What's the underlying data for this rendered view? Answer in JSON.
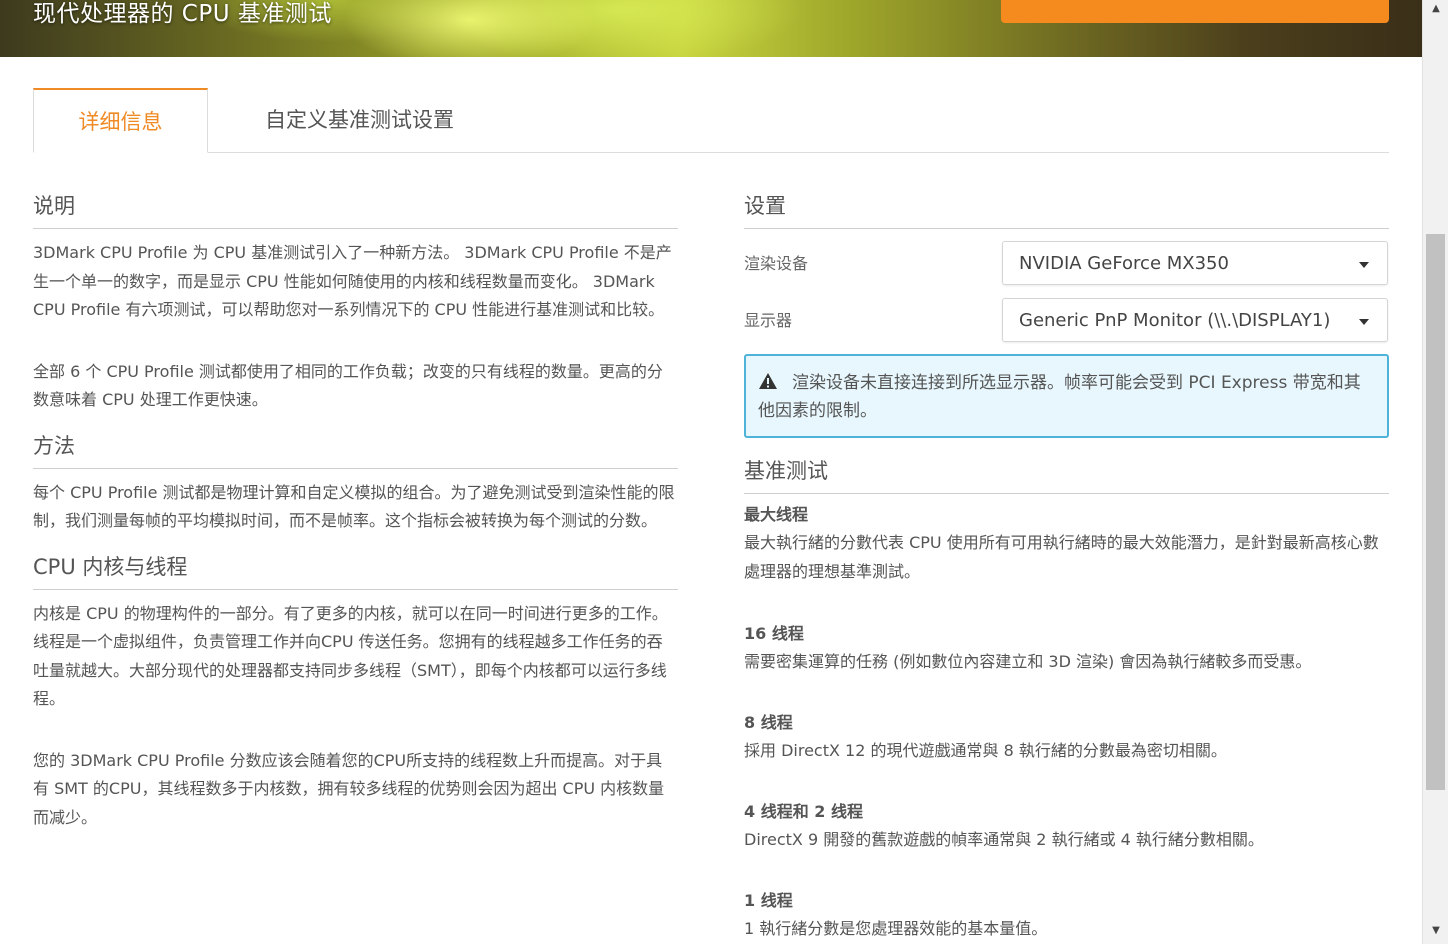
{
  "header": {
    "title": "现代处理器的 CPU 基准测试",
    "run_button_label": ""
  },
  "tabs": [
    {
      "label": "详细信息",
      "active": true
    },
    {
      "label": "自定义基准测试设置",
      "active": false
    }
  ],
  "left": {
    "description": {
      "heading": "说明",
      "p1": "3DMark CPU Profile 为 CPU 基准测试引入了一种新方法。 3DMark CPU Profile 不是产生一个单一的数字，而是显示 CPU 性能如何随使用的内核和线程数量而变化。 3DMark CPU Profile 有六项测试，可以帮助您对一系列情况下的 CPU 性能进行基准测试和比较。",
      "p2": "全部 6 个 CPU Profile 测试都使用了相同的工作负载；改变的只有线程的数量。更高的分数意味着 CPU 处理工作更快速。"
    },
    "method": {
      "heading": "方法",
      "p1": "每个 CPU Profile 测试都是物理计算和自定义模拟的组合。为了避免测试受到渲染性能的限制，我们测量每帧的平均模拟时间，而不是帧率。这个指标会被转换为每个测试的分数。"
    },
    "cores": {
      "heading": "CPU 内核与线程",
      "p1": "内核是 CPU 的物理构件的一部分。有了更多的内核，就可以在同一时间进行更多的工作。线程是一个虚拟组件，负责管理工作并向CPU 传送任务。您拥有的线程越多工作任务的吞吐量就越大。大部分现代的处理器都支持同步多线程（SMT），即每个内核都可以运行多线程。",
      "p2": "您的 3DMark CPU Profile 分数应该会随着您的CPU所支持的线程数上升而提高。对于具有 SMT 的CPU，其线程数多于内核数，拥有较多线程的优势则会因为超出 CPU 内核数量而减少。"
    }
  },
  "right": {
    "settings": {
      "heading": "设置",
      "render_device_label": "渲染设备",
      "render_device_value": "NVIDIA GeForce MX350",
      "monitor_label": "显示器",
      "monitor_value": "Generic PnP Monitor (\\\\.\\DISPLAY1)",
      "warning": "渲染设备未直接连接到所选显示器。帧率可能会受到 PCI Express 带宽和其他因素的限制。"
    },
    "benchmarks": {
      "heading": "基准测试",
      "items": [
        {
          "title": "最大线程",
          "desc": "最大執行緒的分數代表 CPU 使用所有可用執行緒時的最大效能潛力，是針對最新高核心數處理器的理想基準測試。"
        },
        {
          "title": "16 线程",
          "desc": "需要密集運算的任務 (例如數位內容建立和 3D 渲染) 會因為執行緒較多而受惠。"
        },
        {
          "title": "8 线程",
          "desc": "採用 DirectX 12 的現代遊戲通常與 8 執行緒的分數最為密切相關。"
        },
        {
          "title": "4 线程和 2 线程",
          "desc": "DirectX 9 開發的舊款遊戲的幀率通常與 2 執行緒或 4 執行緒分數相關。"
        },
        {
          "title": "1 线程",
          "desc": "1 執行緒分數是您處理器效能的基本量值。"
        }
      ]
    }
  },
  "colors": {
    "accent": "#f08a24",
    "run_button": "#f58a1f",
    "alert_border": "#4fb3d9",
    "alert_bg": "#e7f7fd"
  },
  "icons": {
    "warning": "warning-icon",
    "dropdown": "chevron-down-icon",
    "scroll_up": "scroll-up-icon",
    "scroll_down": "scroll-down-icon"
  }
}
